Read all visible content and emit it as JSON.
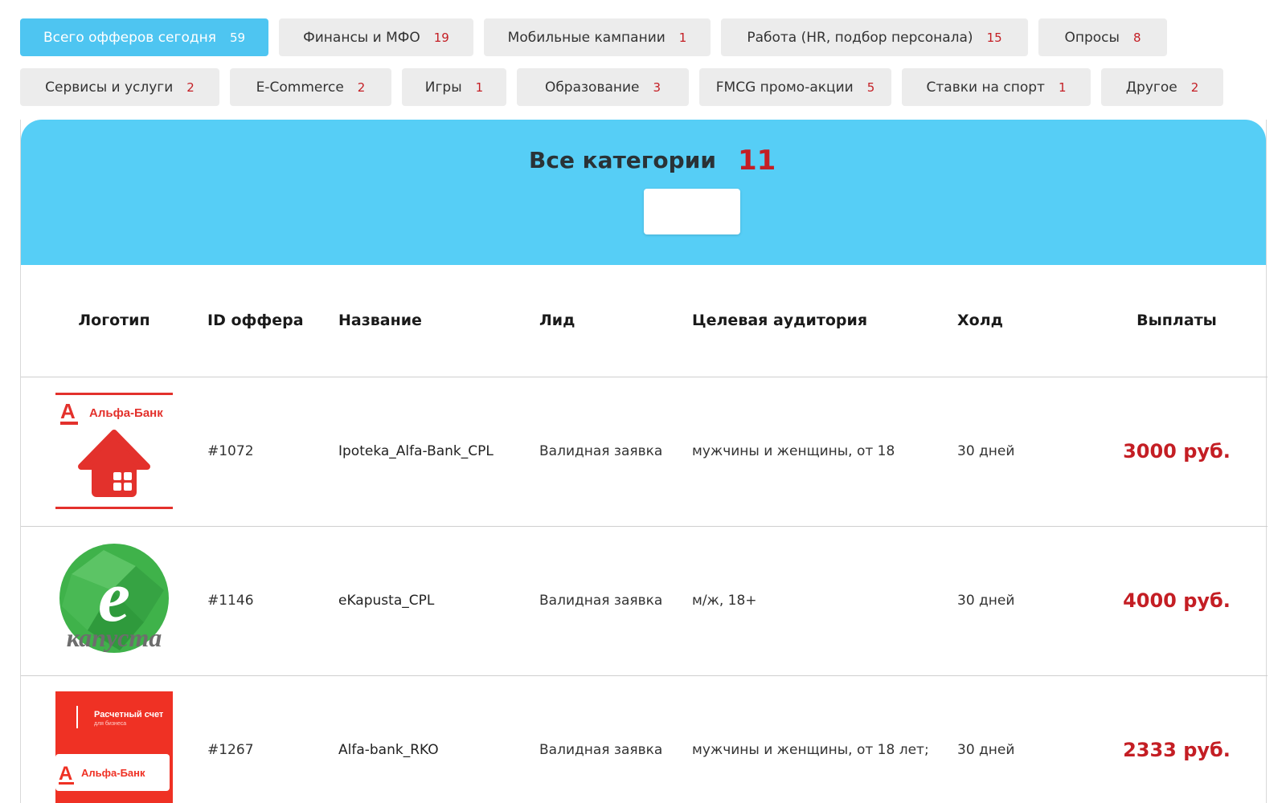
{
  "filters": {
    "row1": [
      {
        "label": "Всего офферов сегодня",
        "count": "59",
        "active": true,
        "width": 309
      },
      {
        "label": "Финансы и МФО",
        "count": "19",
        "active": false,
        "width": 242
      },
      {
        "label": "Мобильные кампании",
        "count": "1",
        "active": false,
        "width": 282
      },
      {
        "label": "Работа (HR, подбор персонала)",
        "count": "15",
        "active": false,
        "width": 382
      },
      {
        "label": "Опросы",
        "count": "8",
        "active": false,
        "width": 160
      }
    ],
    "row2": [
      {
        "label": "Сервисы и услуги",
        "count": "2",
        "width": 248
      },
      {
        "label": "E-Commerce",
        "count": "2",
        "width": 201
      },
      {
        "label": "Игры",
        "count": "1",
        "width": 130
      },
      {
        "label": "Образование",
        "count": "3",
        "width": 214
      },
      {
        "label": "FMCG промо-акции",
        "count": "5",
        "width": 239
      },
      {
        "label": "Ставки на спорт",
        "count": "1",
        "width": 235
      },
      {
        "label": "Другое",
        "count": "2",
        "width": 152
      }
    ]
  },
  "hero": {
    "title": "Все категории",
    "count": "11"
  },
  "table": {
    "headers": {
      "logo": "Логотип",
      "id": "ID оффера",
      "name": "Название",
      "lead": "Лид",
      "audience": "Целевая аудитория",
      "hold": "Холд",
      "payout": "Выплаты"
    },
    "rows": [
      {
        "logo": "alfa-bank-house-logo",
        "logo_text": "Альфа-Банк",
        "id": "#1072",
        "name": "Ipoteka_Alfa-Bank_CPL",
        "lead": "Валидная заявка",
        "audience": "мужчины и женщины, от 18",
        "hold": "30 дней",
        "payout": "3000 руб."
      },
      {
        "logo": "ekapusta-logo",
        "logo_text": "капуста",
        "id": "#1146",
        "name": "eKapusta_CPL",
        "lead": "Валидная заявка",
        "audience": "м/ж, 18+",
        "hold": "30 дней",
        "payout": "4000 руб."
      },
      {
        "logo": "alfa-bank-rko-logo",
        "logo_text": "Альфа-Банк",
        "logo_subtitle": "Расчетный счет",
        "logo_caption": "для бизнеса",
        "id": "#1267",
        "name": "Alfa-bank_RKO",
        "lead": "Валидная заявка",
        "audience": "мужчины и женщины, от 18 лет;",
        "hold": "30 дней",
        "payout": "2333 руб."
      }
    ]
  },
  "colors": {
    "accent": "#56cef6",
    "active_chip": "#4ec5f1",
    "count_red": "#c41e24",
    "chip_bg": "#ececec"
  }
}
